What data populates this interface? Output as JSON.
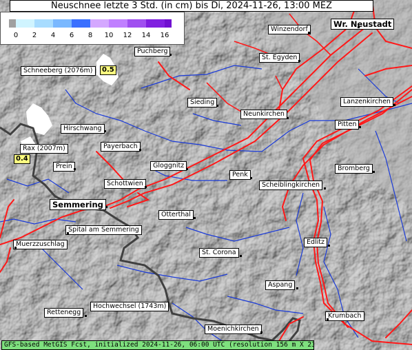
{
  "title": "Neuschnee letzte 3 Std. (in cm) bis Di, 2024-11-26, 13:00 MEZ",
  "legend": {
    "ticks": [
      "0",
      "2",
      "4",
      "6",
      "8",
      "10",
      "12",
      "14",
      "16"
    ],
    "colors": [
      "#d0f4ff",
      "#a8dcff",
      "#7ab8ff",
      "#3a70ff",
      "#d4a8ff",
      "#c080ff",
      "#a050f0",
      "#8020e0"
    ],
    "below_color": "#a0a0a0",
    "above_color": "#7010d0"
  },
  "places": {
    "wr_neustadt": "Wr. Neustadt",
    "winzendorf": "Winzendorf",
    "puchberg": "Puchberg",
    "st_egyden": "St. Egyden",
    "schneeberg": "Schneeberg (2076m)",
    "sieding": "Sieding",
    "neunkirchen": "Neunkirchen",
    "lanzenkirchen": "Lanzenkirchen",
    "pitten": "Pitten",
    "hirschwang": "Hirschwang",
    "rax": "Rax (2007m)",
    "payerbach": "Payerbach",
    "prein": "Prein",
    "gloggnitz": "Gloggnitz",
    "bromberg": "Bromberg",
    "penk": "Penk",
    "schottwien": "Schottwien",
    "scheiblingkirchen": "Scheiblingkirchen",
    "semmering": "Semmering",
    "otterthal": "Otterthal",
    "spital": "Spital am Semmering",
    "edlitz": "Edlitz",
    "muerzzuschlag": "Muerzzuschlag",
    "st_corona": "St. Corona",
    "aspang": "Aspang",
    "hochwechsel": "Hochwechsel (1743m)",
    "rettenegg": "Rettenegg",
    "krumbach": "Krumbach",
    "moenichkirchen": "Moenichkirchen"
  },
  "values": {
    "schneeberg": "0.5",
    "rax": "0.4"
  },
  "footer": "GFS-based MetGIS Fcst, initialized 2024-11-26, 06:00 UTC (resolution 156 m X 231 m)"
}
